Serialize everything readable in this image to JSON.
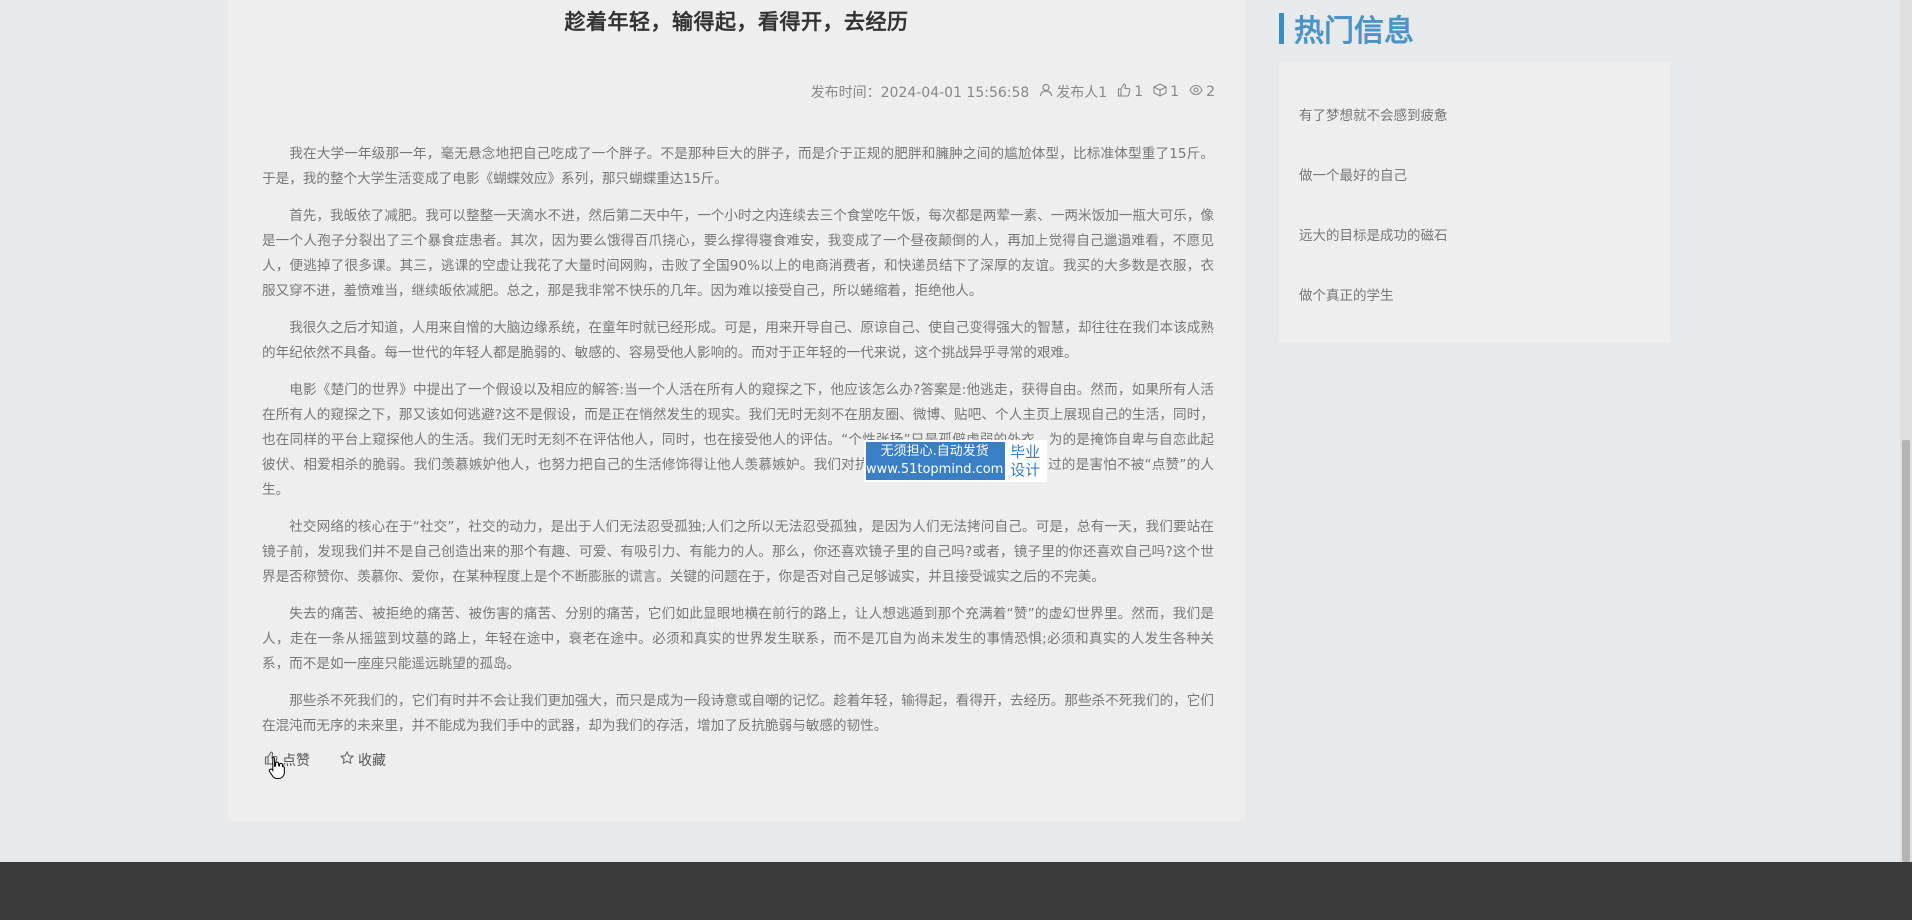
{
  "article": {
    "title": "趁着年轻，输得起，看得开，去经历",
    "meta": {
      "publish_label": "发布时间：2024-04-01 15:56:58",
      "author": "发布人1",
      "likes": "1",
      "favorites": "1",
      "views": "2"
    },
    "paragraphs": [
      "我在大学一年级那一年，毫无悬念地把自己吃成了一个胖子。不是那种巨大的胖子，而是介于正规的肥胖和臃肿之间的尴尬体型，比标准体型重了15斤。于是，我的整个大学生活变成了电影《蝴蝶效应》系列，那只蝴蝶重达15斤。",
      "首先，我皈依了减肥。我可以整整一天滴水不进，然后第二天中午，一个小时之内连续去三个食堂吃午饭，每次都是两荤一素、一两米饭加一瓶大可乐，像是一个人孢子分裂出了三个暴食症患者。其次，因为要么饿得百爪挠心，要么撑得寝食难安，我变成了一个昼夜颠倒的人，再加上觉得自己邋遢难看，不愿见人，便逃掉了很多课。其三，逃课的空虚让我花了大量时间网购，击败了全国90%以上的电商消费者，和快递员结下了深厚的友谊。我买的大多数是衣服，衣服又穿不进，羞愤难当，继续皈依减肥。总之，那是我非常不快乐的几年。因为难以接受自己，所以蜷缩着，拒绝他人。",
      "我很久之后才知道，人用来自憎的大脑边缘系统，在童年时就已经形成。可是，用来开导自己、原谅自己、使自己变得强大的智慧，却往往在我们本该成熟的年纪依然不具备。每一世代的年轻人都是脆弱的、敏感的、容易受他人影响的。而对于正年轻的一代来说，这个挑战异乎寻常的艰难。",
      "电影《楚门的世界》中提出了一个假设以及相应的解答:当一个人活在所有人的窥探之下，他应该怎么办?答案是:他逃走，获得自由。然而，如果所有人活在所有人的窥探之下，那又该如何逃避?这不是假设，而是正在悄然发生的现实。我们无时无刻不在朋友圈、微博、贴吧、个人主页上展现自己的生活，同时，也在同样的平台上窥探他人的生活。我们无时无刻不在评估他人，同时，也在接受他人的评估。“个性张扬”只是孤僻虚弱的外衣，为的是掩饰自卑与自恋此起彼伏、相爱相杀的脆弱。我们羡慕嫉妒他人，也努力把自己的生活修饰得让他人羡慕嫉妒。我们对抗的，是一个充满赞许的世界，过的是害怕不被“点赞”的人生。",
      "社交网络的核心在于“社交”，社交的动力，是出于人们无法忍受孤独;人们之所以无法忍受孤独，是因为人们无法拷问自己。可是，总有一天，我们要站在镜子前，发现我们并不是自己创造出来的那个有趣、可爱、有吸引力、有能力的人。那么，你还喜欢镜子里的自己吗?或者，镜子里的你还喜欢自己吗?这个世界是否称赞你、羡慕你、爱你，在某种程度上是个不断膨胀的谎言。关键的问题在于，你是否对自己足够诚实，并且接受诚实之后的不完美。",
      "失去的痛苦、被拒绝的痛苦、被伤害的痛苦、分别的痛苦，它们如此显眼地横在前行的路上，让人想逃遁到那个充满着“赞”的虚幻世界里。然而，我们是人，走在一条从摇篮到坟墓的路上，年轻在途中，衰老在途中。必须和真实的世界发生联系，而不是兀自为尚未发生的事情恐惧;必须和真实的人发生各种关系，而不是如一座座只能遥远眺望的孤岛。",
      "那些杀不死我们的，它们有时并不会让我们更加强大，而只是成为一段诗意或自嘲的记忆。趁着年轻，输得起，看得开，去经历。那些杀不死我们的，它们在混沌而无序的未来里，并不能成为我们手中的武器，却为我们的存活，增加了反抗脆弱与敏感的韧性。"
    ],
    "actions": {
      "like": "点赞",
      "favorite": "收藏"
    }
  },
  "watermark": {
    "line1": "无须担心.自动发货",
    "line2": "www.51topmind.com",
    "badge1": "毕业",
    "badge2": "设计"
  },
  "sidebar": {
    "title": "热门信息",
    "items": [
      "有了梦想就不会感到疲惫",
      "做一个最好的自己",
      "远大的目标是成功的磁石",
      "做个真正的学生"
    ]
  },
  "colors": {
    "accent": "#4a94c6",
    "footer": "#3b3b3b",
    "watermark": "#3a7ec4"
  }
}
